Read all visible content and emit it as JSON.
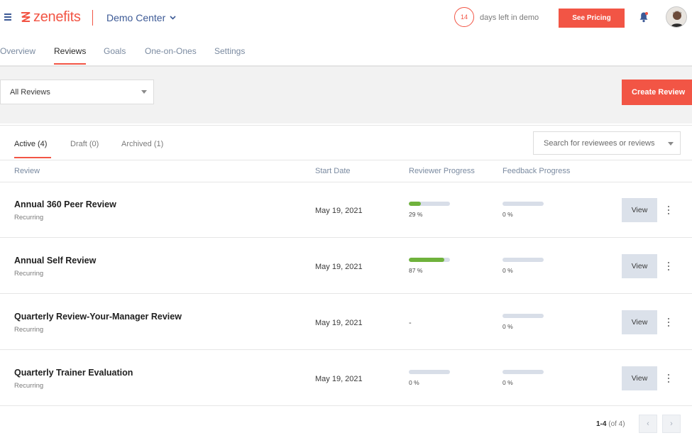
{
  "header": {
    "logo_text": "zenefits",
    "company": "Demo Center",
    "days_left": "14",
    "days_left_text": "days left in demo",
    "pricing_button": "See Pricing"
  },
  "nav": {
    "items": [
      {
        "label": "Overview",
        "active": false
      },
      {
        "label": "Reviews",
        "active": true
      },
      {
        "label": "Goals",
        "active": false
      },
      {
        "label": "One-on-Ones",
        "active": false
      },
      {
        "label": "Settings",
        "active": false
      }
    ]
  },
  "toolbar": {
    "filter_value": "All Reviews",
    "create_button": "Create Review"
  },
  "subtabs": [
    {
      "label": "Active (4)",
      "active": true
    },
    {
      "label": "Draft (0)",
      "active": false
    },
    {
      "label": "Archived (1)",
      "active": false
    }
  ],
  "search": {
    "placeholder": "Search for reviewees or reviews"
  },
  "table": {
    "columns": [
      "Review",
      "Start Date",
      "Reviewer Progress",
      "Feedback Progress"
    ],
    "rows": [
      {
        "title": "Annual 360 Peer Review",
        "subtitle": "Recurring",
        "start_date": "May 19, 2021",
        "reviewer_progress": 29,
        "reviewer_label": "29 %",
        "feedback_progress": 0,
        "feedback_label": "0 %",
        "action": "View"
      },
      {
        "title": "Annual Self Review",
        "subtitle": "Recurring",
        "start_date": "May 19, 2021",
        "reviewer_progress": 87,
        "reviewer_label": "87 %",
        "feedback_progress": 0,
        "feedback_label": "0 %",
        "action": "View"
      },
      {
        "title": "Quarterly Review-Your-Manager Review",
        "subtitle": "Recurring",
        "start_date": "May 19, 2021",
        "reviewer_progress": null,
        "reviewer_label": "-",
        "feedback_progress": 0,
        "feedback_label": "0 %",
        "action": "View"
      },
      {
        "title": "Quarterly Trainer Evaluation",
        "subtitle": "Recurring",
        "start_date": "May 19, 2021",
        "reviewer_progress": 0,
        "reviewer_label": "0 %",
        "feedback_progress": 0,
        "feedback_label": "0 %",
        "action": "View"
      }
    ]
  },
  "pagination": {
    "range": "1-4",
    "total": "(of 4)",
    "prev_icon": "‹",
    "next_icon": "›"
  },
  "colors": {
    "brand": "#f25545",
    "nav_blue": "#3d5a96",
    "progress_green": "#6fb23c",
    "progress_track": "#d8dee8"
  }
}
